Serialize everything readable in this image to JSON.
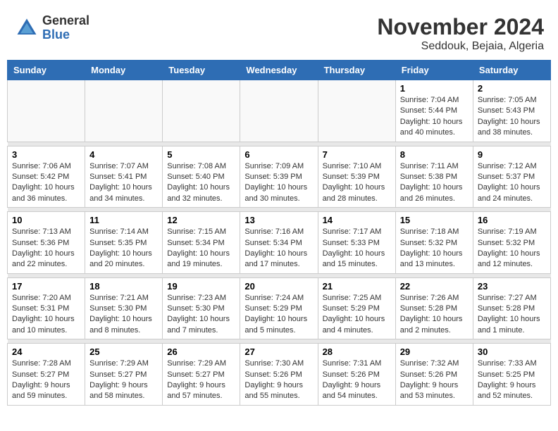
{
  "logo": {
    "general": "General",
    "blue": "Blue"
  },
  "title": "November 2024",
  "location": "Seddouk, Bejaia, Algeria",
  "headers": [
    "Sunday",
    "Monday",
    "Tuesday",
    "Wednesday",
    "Thursday",
    "Friday",
    "Saturday"
  ],
  "weeks": [
    [
      {
        "day": "",
        "info": ""
      },
      {
        "day": "",
        "info": ""
      },
      {
        "day": "",
        "info": ""
      },
      {
        "day": "",
        "info": ""
      },
      {
        "day": "",
        "info": ""
      },
      {
        "day": "1",
        "info": "Sunrise: 7:04 AM\nSunset: 5:44 PM\nDaylight: 10 hours and 40 minutes."
      },
      {
        "day": "2",
        "info": "Sunrise: 7:05 AM\nSunset: 5:43 PM\nDaylight: 10 hours and 38 minutes."
      }
    ],
    [
      {
        "day": "3",
        "info": "Sunrise: 7:06 AM\nSunset: 5:42 PM\nDaylight: 10 hours and 36 minutes."
      },
      {
        "day": "4",
        "info": "Sunrise: 7:07 AM\nSunset: 5:41 PM\nDaylight: 10 hours and 34 minutes."
      },
      {
        "day": "5",
        "info": "Sunrise: 7:08 AM\nSunset: 5:40 PM\nDaylight: 10 hours and 32 minutes."
      },
      {
        "day": "6",
        "info": "Sunrise: 7:09 AM\nSunset: 5:39 PM\nDaylight: 10 hours and 30 minutes."
      },
      {
        "day": "7",
        "info": "Sunrise: 7:10 AM\nSunset: 5:39 PM\nDaylight: 10 hours and 28 minutes."
      },
      {
        "day": "8",
        "info": "Sunrise: 7:11 AM\nSunset: 5:38 PM\nDaylight: 10 hours and 26 minutes."
      },
      {
        "day": "9",
        "info": "Sunrise: 7:12 AM\nSunset: 5:37 PM\nDaylight: 10 hours and 24 minutes."
      }
    ],
    [
      {
        "day": "10",
        "info": "Sunrise: 7:13 AM\nSunset: 5:36 PM\nDaylight: 10 hours and 22 minutes."
      },
      {
        "day": "11",
        "info": "Sunrise: 7:14 AM\nSunset: 5:35 PM\nDaylight: 10 hours and 20 minutes."
      },
      {
        "day": "12",
        "info": "Sunrise: 7:15 AM\nSunset: 5:34 PM\nDaylight: 10 hours and 19 minutes."
      },
      {
        "day": "13",
        "info": "Sunrise: 7:16 AM\nSunset: 5:34 PM\nDaylight: 10 hours and 17 minutes."
      },
      {
        "day": "14",
        "info": "Sunrise: 7:17 AM\nSunset: 5:33 PM\nDaylight: 10 hours and 15 minutes."
      },
      {
        "day": "15",
        "info": "Sunrise: 7:18 AM\nSunset: 5:32 PM\nDaylight: 10 hours and 13 minutes."
      },
      {
        "day": "16",
        "info": "Sunrise: 7:19 AM\nSunset: 5:32 PM\nDaylight: 10 hours and 12 minutes."
      }
    ],
    [
      {
        "day": "17",
        "info": "Sunrise: 7:20 AM\nSunset: 5:31 PM\nDaylight: 10 hours and 10 minutes."
      },
      {
        "day": "18",
        "info": "Sunrise: 7:21 AM\nSunset: 5:30 PM\nDaylight: 10 hours and 8 minutes."
      },
      {
        "day": "19",
        "info": "Sunrise: 7:23 AM\nSunset: 5:30 PM\nDaylight: 10 hours and 7 minutes."
      },
      {
        "day": "20",
        "info": "Sunrise: 7:24 AM\nSunset: 5:29 PM\nDaylight: 10 hours and 5 minutes."
      },
      {
        "day": "21",
        "info": "Sunrise: 7:25 AM\nSunset: 5:29 PM\nDaylight: 10 hours and 4 minutes."
      },
      {
        "day": "22",
        "info": "Sunrise: 7:26 AM\nSunset: 5:28 PM\nDaylight: 10 hours and 2 minutes."
      },
      {
        "day": "23",
        "info": "Sunrise: 7:27 AM\nSunset: 5:28 PM\nDaylight: 10 hours and 1 minute."
      }
    ],
    [
      {
        "day": "24",
        "info": "Sunrise: 7:28 AM\nSunset: 5:27 PM\nDaylight: 9 hours and 59 minutes."
      },
      {
        "day": "25",
        "info": "Sunrise: 7:29 AM\nSunset: 5:27 PM\nDaylight: 9 hours and 58 minutes."
      },
      {
        "day": "26",
        "info": "Sunrise: 7:29 AM\nSunset: 5:27 PM\nDaylight: 9 hours and 57 minutes."
      },
      {
        "day": "27",
        "info": "Sunrise: 7:30 AM\nSunset: 5:26 PM\nDaylight: 9 hours and 55 minutes."
      },
      {
        "day": "28",
        "info": "Sunrise: 7:31 AM\nSunset: 5:26 PM\nDaylight: 9 hours and 54 minutes."
      },
      {
        "day": "29",
        "info": "Sunrise: 7:32 AM\nSunset: 5:26 PM\nDaylight: 9 hours and 53 minutes."
      },
      {
        "day": "30",
        "info": "Sunrise: 7:33 AM\nSunset: 5:25 PM\nDaylight: 9 hours and 52 minutes."
      }
    ]
  ]
}
